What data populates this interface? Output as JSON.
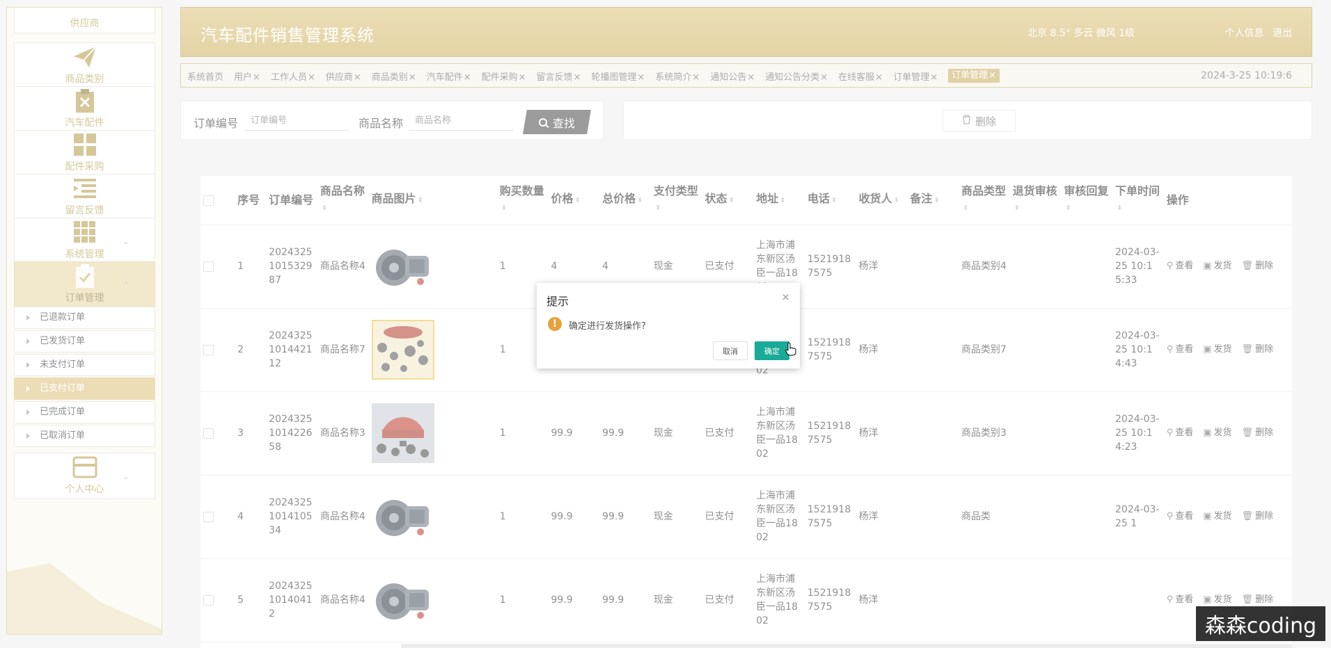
{
  "app": {
    "title": "汽车配件销售管理系统"
  },
  "header": {
    "weather": "北京  8.5°  多云  微风  1级",
    "user_links": [
      "个人信息",
      "退出"
    ]
  },
  "sidebar": {
    "items": [
      {
        "label": "供应商",
        "icon": "truck-icon"
      },
      {
        "label": "商品类别",
        "icon": "paper-plane-icon"
      },
      {
        "label": "汽车配件",
        "icon": "clipboard-x-icon"
      },
      {
        "label": "配件采购",
        "icon": "grid-icon"
      },
      {
        "label": "留言反馈",
        "icon": "list-indent-icon"
      },
      {
        "label": "系统管理",
        "icon": "apps-icon",
        "expand": "⌄"
      },
      {
        "label": "订单管理",
        "icon": "clipboard-check-icon",
        "expand": "⌃"
      },
      {
        "label": "个人中心",
        "icon": "wallet-icon",
        "expand": "⌄"
      }
    ],
    "sub_items": [
      "已退款订单",
      "已发货订单",
      "未支付订单",
      "已支付订单",
      "已完成订单",
      "已取消订单"
    ],
    "active_sub": "已支付订单"
  },
  "tabs": {
    "items": [
      {
        "label": "系统首页",
        "closable": false
      },
      {
        "label": "用户",
        "closable": true
      },
      {
        "label": "工作人员",
        "closable": true
      },
      {
        "label": "供应商",
        "closable": true
      },
      {
        "label": "商品类别",
        "closable": true
      },
      {
        "label": "汽车配件",
        "closable": true
      },
      {
        "label": "配件采购",
        "closable": true
      },
      {
        "label": "留言反馈",
        "closable": true
      },
      {
        "label": "轮播图管理",
        "closable": true
      },
      {
        "label": "系统简介",
        "closable": true
      },
      {
        "label": "通知公告",
        "closable": true
      },
      {
        "label": "通知公告分类",
        "closable": true
      },
      {
        "label": "在线客服",
        "closable": true
      },
      {
        "label": "订单管理",
        "closable": true
      },
      {
        "label": "订单管理",
        "closable": true,
        "active": true
      }
    ],
    "close_glyph": "×",
    "datetime": "2024-3-25 10:19:6"
  },
  "search": {
    "order_no_label": "订单编号",
    "order_no_placeholder": "订单编号",
    "product_name_label": "商品名称",
    "product_name_placeholder": "商品名称",
    "search_button": "查找"
  },
  "actions": {
    "delete_button": "删除"
  },
  "table": {
    "headers": [
      "序号",
      "订单编号",
      "商品名称",
      "商品图片",
      "购买数量",
      "价格",
      "总价格",
      "支付类型",
      "状态",
      "地址",
      "电话",
      "收货人",
      "备注",
      "商品类型",
      "退货审核",
      "审核回复",
      "下单时间",
      "操作"
    ],
    "rows": [
      {
        "index": "1",
        "order_no": "2024325101532987",
        "name": "商品名称4",
        "img": "engine",
        "qty": "1",
        "price": "4",
        "total": "4",
        "pay": "现金",
        "status": "已支付",
        "address": "上海市浦东新区汤臣一品1802",
        "phone": "15219187575",
        "receiver": "杨洋",
        "note": "",
        "type": "商品类别4",
        "return_review": "",
        "review_reply": "",
        "time": "2024-03-25 10:15:33"
      },
      {
        "index": "2",
        "order_no": "2024325101442112",
        "name": "商品名称7",
        "img": "parts",
        "qty": "1",
        "price": "",
        "total": "",
        "pay": "",
        "status": "",
        "address": "上海市浦东新区汤臣一品1802",
        "phone": "15219187575",
        "receiver": "杨洋",
        "note": "",
        "type": "商品类别7",
        "return_review": "",
        "review_reply": "",
        "time": "2024-03-25 10:14:43"
      },
      {
        "index": "3",
        "order_no": "2024325101422658",
        "name": "商品名称3",
        "img": "car-parts",
        "qty": "1",
        "price": "99.9",
        "total": "99.9",
        "pay": "现金",
        "status": "已支付",
        "address": "上海市浦东新区汤臣一品1802",
        "phone": "15219187575",
        "receiver": "杨洋",
        "note": "",
        "type": "商品类别3",
        "return_review": "",
        "review_reply": "",
        "time": "2024-03-25 10:14:23"
      },
      {
        "index": "4",
        "order_no": "2024325101410534",
        "name": "商品名称4",
        "img": "engine",
        "qty": "1",
        "price": "99.9",
        "total": "99.9",
        "pay": "现金",
        "status": "已支付",
        "address": "上海市浦东新区汤臣一品1802",
        "phone": "15219187575",
        "receiver": "杨洋",
        "note": "",
        "type": "商品类",
        "return_review": "",
        "review_reply": "",
        "time": "2024-03-25 1"
      },
      {
        "index": "5",
        "order_no": "202432510140412",
        "name": "商品名称4",
        "img": "engine",
        "qty": "1",
        "price": "99.9",
        "total": "99.9",
        "pay": "现金",
        "status": "已支付",
        "address": "上海市浦东新区汤臣一品1802",
        "phone": "15219187575",
        "receiver": "杨洋",
        "note": "",
        "type": "",
        "return_review": "",
        "review_reply": "",
        "time": ""
      }
    ],
    "row_actions": [
      "查看",
      "发货",
      "删除"
    ]
  },
  "dialog": {
    "title": "提示",
    "close": "×",
    "message": "确定进行发货操作?",
    "cancel": "取消",
    "confirm": "确定"
  },
  "watermark": "森森coding",
  "colors": {
    "gold": "#cdb15d",
    "teal": "#1aaa98",
    "warning": "#e6a23c"
  }
}
